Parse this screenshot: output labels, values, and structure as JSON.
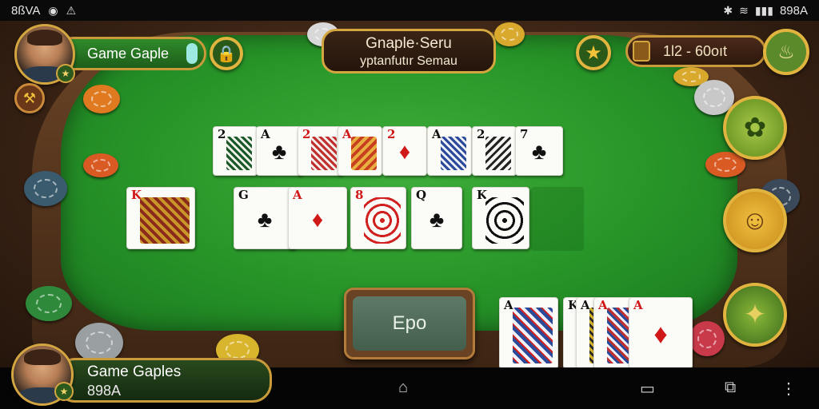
{
  "status_bar": {
    "left_text": "8ßVA",
    "right_text": "898A"
  },
  "hud": {
    "player_name": "Game Gaple",
    "title_line1": "Gnaple·Seru",
    "title_line2": "yptanfutır Semau",
    "coins_text": "1l2 - 60oıt",
    "action_label": "Epo",
    "bottom_player_name": "Game Gaples",
    "bottom_player_coins": "898A"
  },
  "table": {
    "top_row": [
      {
        "rank": "2",
        "color": "black",
        "pattern": true
      },
      {
        "rank": "A",
        "color": "black",
        "pattern": false,
        "suit": "♣"
      },
      {
        "rank": "2",
        "color": "red",
        "pattern": true
      },
      {
        "rank": "A",
        "color": "red",
        "pattern": true
      },
      {
        "rank": "2",
        "color": "red",
        "pattern": false,
        "suit": "♦"
      },
      {
        "rank": "A",
        "color": "black",
        "pattern": true
      },
      {
        "rank": "2",
        "color": "black",
        "pattern": true
      },
      {
        "rank": "7",
        "color": "black",
        "pattern": false,
        "suit": "♣"
      }
    ],
    "middle_row": [
      {
        "rank": "K",
        "color": "red",
        "pattern": true
      },
      {
        "rank": "G",
        "color": "black",
        "pattern": false,
        "suit": "♣"
      },
      {
        "rank": "A",
        "color": "red",
        "pattern": false,
        "suit": "♦"
      },
      {
        "rank": "8",
        "color": "red",
        "pattern": true
      },
      {
        "rank": "Q",
        "color": "black",
        "pattern": false,
        "suit": "♣"
      },
      {
        "rank": "K",
        "color": "black",
        "pattern": true
      }
    ],
    "hand": [
      {
        "rank": "A",
        "color": "black",
        "pattern": true
      },
      {
        "rank": "K",
        "color": "black",
        "pattern": true
      },
      {
        "rank": "A",
        "color": "black",
        "pattern": true
      },
      {
        "rank": "A",
        "color": "red",
        "pattern": true
      },
      {
        "rank": "A",
        "color": "red",
        "pattern": false,
        "suit": "♦"
      }
    ]
  },
  "colors": {
    "felt": "#279428",
    "gold": "#d4a640",
    "wood": "#3b2415"
  }
}
